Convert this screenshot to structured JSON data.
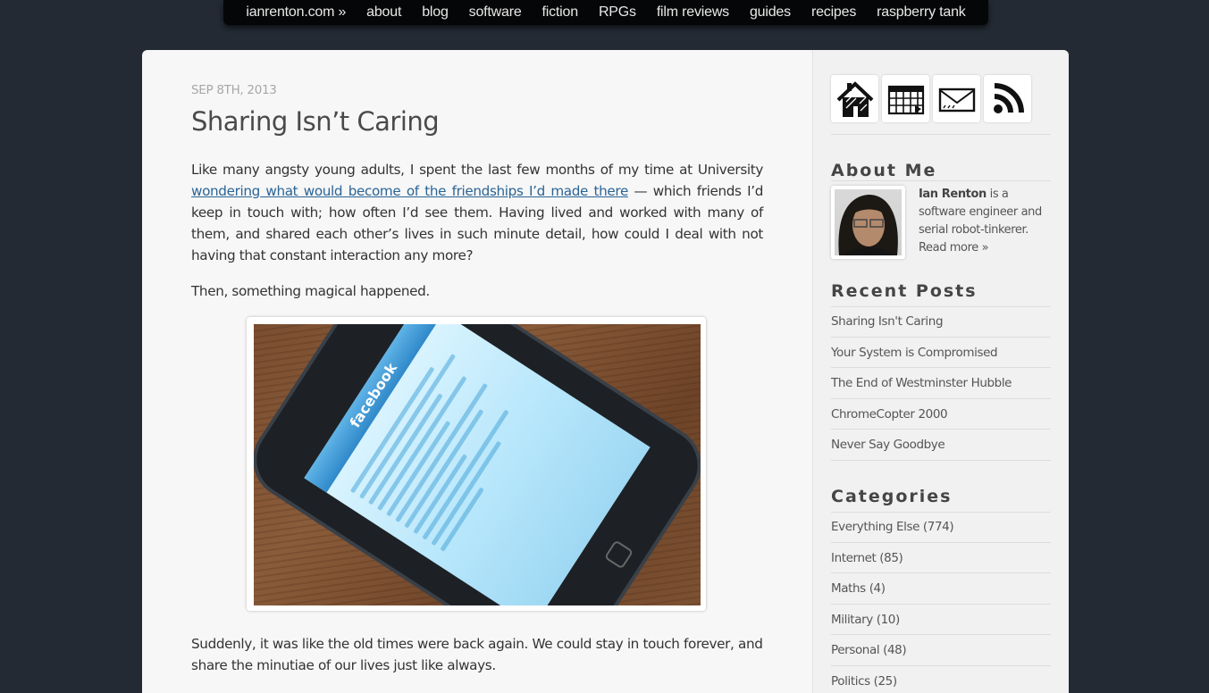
{
  "nav": {
    "items": [
      {
        "label": "ianrenton.com »"
      },
      {
        "label": "about"
      },
      {
        "label": "blog"
      },
      {
        "label": "software"
      },
      {
        "label": "fiction"
      },
      {
        "label": "RPGs"
      },
      {
        "label": "film reviews"
      },
      {
        "label": "guides"
      },
      {
        "label": "recipes"
      },
      {
        "label": "raspberry tank"
      }
    ]
  },
  "post": {
    "date": "SEP 8TH, 2013",
    "title": "Sharing Isn’t Caring",
    "p1_before_link": "Like many angsty young adults, I spent the last few months of my time at University ",
    "p1_link": "wondering what would become of the friendships I’d made there",
    "p1_after_link": " — which friends I’d keep in touch with; how often I’d see them. Having lived and worked with many of them, and shared each other’s lives in such minute detail, how could I deal with not having that constant interaction any more?",
    "p2": "Then, something magical happened.",
    "image": {
      "alt": "iPod touch on a wooden desk showing the Facebook app",
      "screen_app": "facebook"
    },
    "p3": "Suddenly, it was like the old times were back again. We could stay in touch forever, and share the minutiae of our lives just like always."
  },
  "sidebar": {
    "icons": [
      {
        "name": "home-icon",
        "label": "Home"
      },
      {
        "name": "calendar-icon",
        "label": "Archive"
      },
      {
        "name": "mail-icon",
        "label": "Contact"
      },
      {
        "name": "rss-icon",
        "label": "RSS"
      }
    ],
    "about": {
      "title": "About Me",
      "name": "Ian Renton",
      "text": " is a software engineer and serial robot-tinkerer.",
      "read_more": "Read more »"
    },
    "recent": {
      "title": "Recent Posts",
      "items": [
        "Sharing Isn't Caring",
        "Your System is Compromised",
        "The End of Westminster Hubble",
        "ChromeCopter 2000",
        "Never Say Goodbye"
      ]
    },
    "categories": {
      "title": "Categories",
      "items": [
        "Everything Else (774)",
        "Internet (85)",
        "Maths (4)",
        "Military (10)",
        "Personal (48)",
        "Politics (25)"
      ]
    }
  },
  "colors": {
    "background": "#232a33",
    "nav_bg": "#050607",
    "content_bg": "#f7f7f7",
    "sidebar_bg": "#f1f1f1",
    "link": "#2a6496"
  }
}
